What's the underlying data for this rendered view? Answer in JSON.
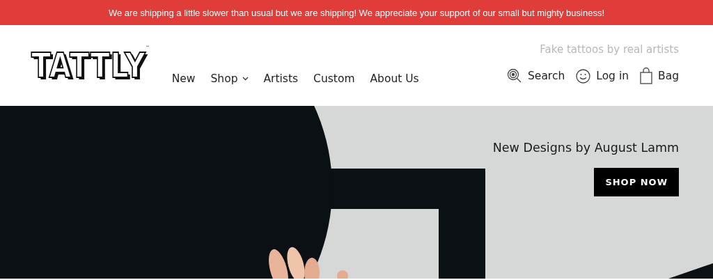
{
  "announcement": "We are shipping a little slower than usual but we are shipping! We appreciate your support of our small but mighty business!",
  "logo": {
    "text": "TATTLY",
    "trademark": "™"
  },
  "nav": [
    {
      "label": "New",
      "dropdown": false
    },
    {
      "label": "Shop",
      "dropdown": true
    },
    {
      "label": "Artists",
      "dropdown": false
    },
    {
      "label": "Custom",
      "dropdown": false
    },
    {
      "label": "About Us",
      "dropdown": false
    }
  ],
  "tagline": "Fake tattoos by real artists",
  "actions": [
    {
      "kind": "search",
      "label": "Search"
    },
    {
      "kind": "account",
      "label": "Log in"
    },
    {
      "kind": "bag",
      "label": "Bag"
    }
  ],
  "hero": {
    "headline": "New Designs by August Lamm",
    "button": "SHOP NOW"
  }
}
